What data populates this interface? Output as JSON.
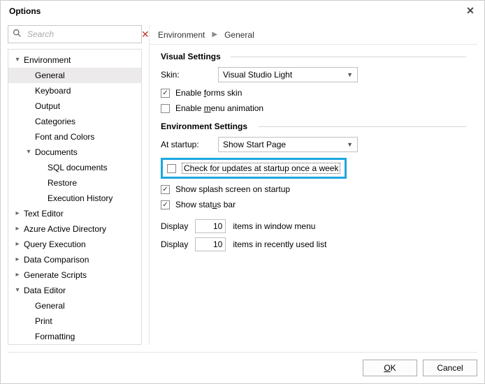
{
  "window": {
    "title": "Options"
  },
  "search": {
    "placeholder": "Search",
    "value": ""
  },
  "tree": {
    "environment": {
      "label": "Environment",
      "general": "General",
      "keyboard": "Keyboard",
      "output": "Output",
      "categories": "Categories",
      "font_colors": "Font and Colors",
      "documents": {
        "label": "Documents",
        "sql_documents": "SQL documents",
        "restore": "Restore",
        "execution_history": "Execution History"
      }
    },
    "text_editor": "Text Editor",
    "aad": "Azure Active Directory",
    "query_execution": "Query Execution",
    "data_comparison": "Data Comparison",
    "generate_scripts": "Generate Scripts",
    "data_editor": {
      "label": "Data Editor",
      "general": "General",
      "print": "Print",
      "formatting": "Formatting"
    }
  },
  "breadcrumb": {
    "level1": "Environment",
    "level2": "General"
  },
  "visual_settings": {
    "title": "Visual Settings",
    "skin_label": "Skin:",
    "skin_value": "Visual Studio Light",
    "enable_forms_skin": "Enable forms skin",
    "enable_menu_animation": "Enable menu animation"
  },
  "env_settings": {
    "title": "Environment Settings",
    "at_startup_label": "At startup:",
    "at_startup_value": "Show Start Page",
    "check_updates": "Check for updates at startup once a week",
    "show_splash": "Show splash screen on startup",
    "show_statusbar": "Show status bar",
    "display_label": "Display",
    "window_menu_count": "10",
    "window_menu_suffix": "items in window menu",
    "recent_count": "10",
    "recent_suffix": "items in recently used list"
  },
  "buttons": {
    "ok": "OK",
    "cancel": "Cancel"
  }
}
